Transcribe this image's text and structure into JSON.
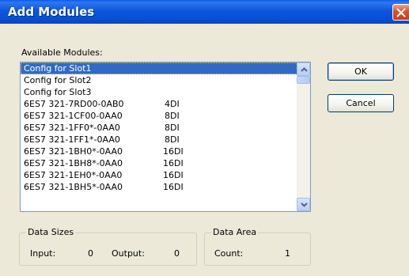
{
  "window": {
    "title": "Add Modules",
    "close_icon": "close-icon"
  },
  "available_label": "Available Modules:",
  "modules": [
    {
      "name": "Config for Slot1",
      "type": ""
    },
    {
      "name": "Config for Slot2",
      "type": ""
    },
    {
      "name": "Config for Slot3",
      "type": ""
    },
    {
      "name": "6ES7 321-7RD00-0AB0",
      "type": "4DI"
    },
    {
      "name": "6ES7 321-1CF00-0AA0",
      "type": "8DI"
    },
    {
      "name": "6ES7 321-1FF0*-0AA0",
      "type": "8DI"
    },
    {
      "name": "6ES7 321-1FF1*-0AA0",
      "type": "8DI"
    },
    {
      "name": "6ES7 321-1BH0*-0AA0",
      "type": "16DI"
    },
    {
      "name": "6ES7 321-1BH8*-0AA0",
      "type": "16DI"
    },
    {
      "name": "6ES7 321-1EH0*-0AA0",
      "type": "16DI"
    },
    {
      "name": "6ES7 321-1BH5*-0AA0",
      "type": "16DI"
    }
  ],
  "selected_index": 0,
  "buttons": {
    "ok": "OK",
    "cancel": "Cancel"
  },
  "data_sizes": {
    "title": "Data Sizes",
    "input_label": "Input:",
    "input_value": "0",
    "output_label": "Output:",
    "output_value": "0"
  },
  "data_area": {
    "title": "Data Area",
    "count_label": "Count:",
    "count_value": "1"
  },
  "colors": {
    "titlebar": "#0750d6",
    "selection": "#316ac5",
    "dialog_bg": "#ece9d8"
  }
}
